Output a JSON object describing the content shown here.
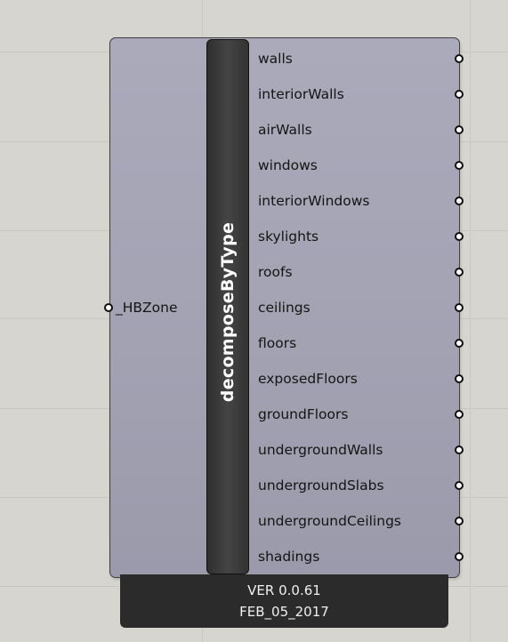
{
  "component": {
    "title": "decomposeByType",
    "input": {
      "label": "_HBZone"
    },
    "outputs": [
      {
        "label": "walls"
      },
      {
        "label": "interiorWalls"
      },
      {
        "label": "airWalls"
      },
      {
        "label": "windows"
      },
      {
        "label": "interiorWindows"
      },
      {
        "label": "skylights"
      },
      {
        "label": "roofs"
      },
      {
        "label": "ceilings"
      },
      {
        "label": "floors"
      },
      {
        "label": "exposedFloors"
      },
      {
        "label": "groundFloors"
      },
      {
        "label": "undergroundWalls"
      },
      {
        "label": "undergroundSlabs"
      },
      {
        "label": "undergroundCeilings"
      },
      {
        "label": "shadings"
      }
    ],
    "version": "VER 0.0.61",
    "date": "FEB_05_2017"
  }
}
